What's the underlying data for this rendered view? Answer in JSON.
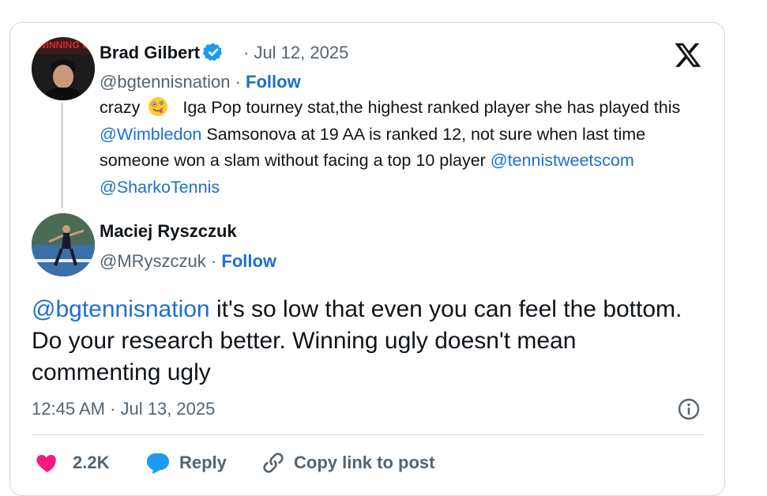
{
  "quoted": {
    "author_name": "Brad Gilbert",
    "date": "· Jul 12, 2025",
    "handle": "@bgtennisnation",
    "follow_sep": "·",
    "follow_label": "Follow",
    "text_1": "crazy",
    "text_2": "Iga Pop tourney stat,the highest ranked player she has played this",
    "mention_1": "@Wimbledon",
    "text_3": "Samsonova at 19 AA is ranked 12, not sure when last time someone won a slam without facing a top 10 player",
    "mention_2": "@tennistweetscom",
    "mention_3": "@SharkoTennis"
  },
  "reply": {
    "author_name": "Maciej Ryszczuk",
    "handle": "@MRyszczuk",
    "follow_sep": "·",
    "follow_label": "Follow",
    "mention": "@bgtennisnation",
    "text": "it's so low that even you can feel the bottom. Do your research better. Winning ugly doesn't mean commenting ugly",
    "timestamp": "12:45 AM · Jul 13, 2025"
  },
  "actions": {
    "like_count": "2.2K",
    "reply_label": "Reply",
    "copy_label": "Copy link to post"
  },
  "colors": {
    "link": "#1d6fd0",
    "like": "#f91880",
    "reply_icon": "#1d9bf0",
    "verified": "#1d9bf0"
  },
  "icons": [
    "x-logo-icon",
    "verified-badge-icon",
    "zany-face-emoji-icon",
    "info-icon",
    "heart-icon",
    "reply-bubble-icon",
    "link-icon"
  ]
}
